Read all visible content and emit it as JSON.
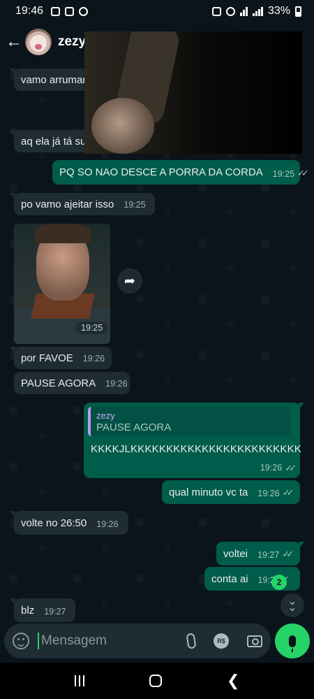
{
  "status_bar": {
    "time": "19:46",
    "battery": "33%",
    "icons": [
      "instagram-icon",
      "gallery-icon",
      "dnd-icon",
      "alarm-icon",
      "wifi-icon",
      "signal-icon",
      "battery-icon"
    ]
  },
  "header": {
    "contact_name": "zezy",
    "back_icon": "arrow-left-icon",
    "avatar_icon": "avatar-icon"
  },
  "messages": [
    {
      "dir": "in",
      "text": "vamo arrumar",
      "time": ""
    },
    {
      "dir": "in",
      "text": "aq ela já tá su",
      "time": ""
    },
    {
      "dir": "out",
      "text": "PQ SO NAO DESCE A PORRA DA CORDA",
      "time": "19:25"
    },
    {
      "dir": "in",
      "text": "po vamo ajeitar isso",
      "time": "19:25"
    },
    {
      "dir": "in",
      "type": "image",
      "time": "19:25"
    },
    {
      "dir": "in",
      "text": "por FAVOE",
      "time": "19:26"
    },
    {
      "dir": "in",
      "text": "PAUSE AGORA",
      "time": "19:26"
    },
    {
      "dir": "out",
      "type": "reply",
      "quote_author": "zezy",
      "quote_text": "PAUSE AGORA",
      "text": "KKKKJLKKKKKKKKKKKKKKKKKKKKKKKK",
      "time": "19:26"
    },
    {
      "dir": "out",
      "text": "qual minuto vc ta",
      "time": "19:26"
    },
    {
      "dir": "in",
      "text": "volte no 26:50",
      "time": "19:26"
    },
    {
      "dir": "out",
      "text": "voltei",
      "time": "19:27"
    },
    {
      "dir": "out",
      "text": "conta ai",
      "time": "19:2"
    },
    {
      "dir": "in",
      "text": "blz",
      "time": "19:27"
    }
  ],
  "unread_count": "2",
  "composer": {
    "placeholder": "Mensagem",
    "pay_label": "R$"
  },
  "colors": {
    "background": "#0b141a",
    "incoming_bubble": "#202c33",
    "outgoing_bubble": "#005c4b",
    "accent": "#25d366"
  }
}
